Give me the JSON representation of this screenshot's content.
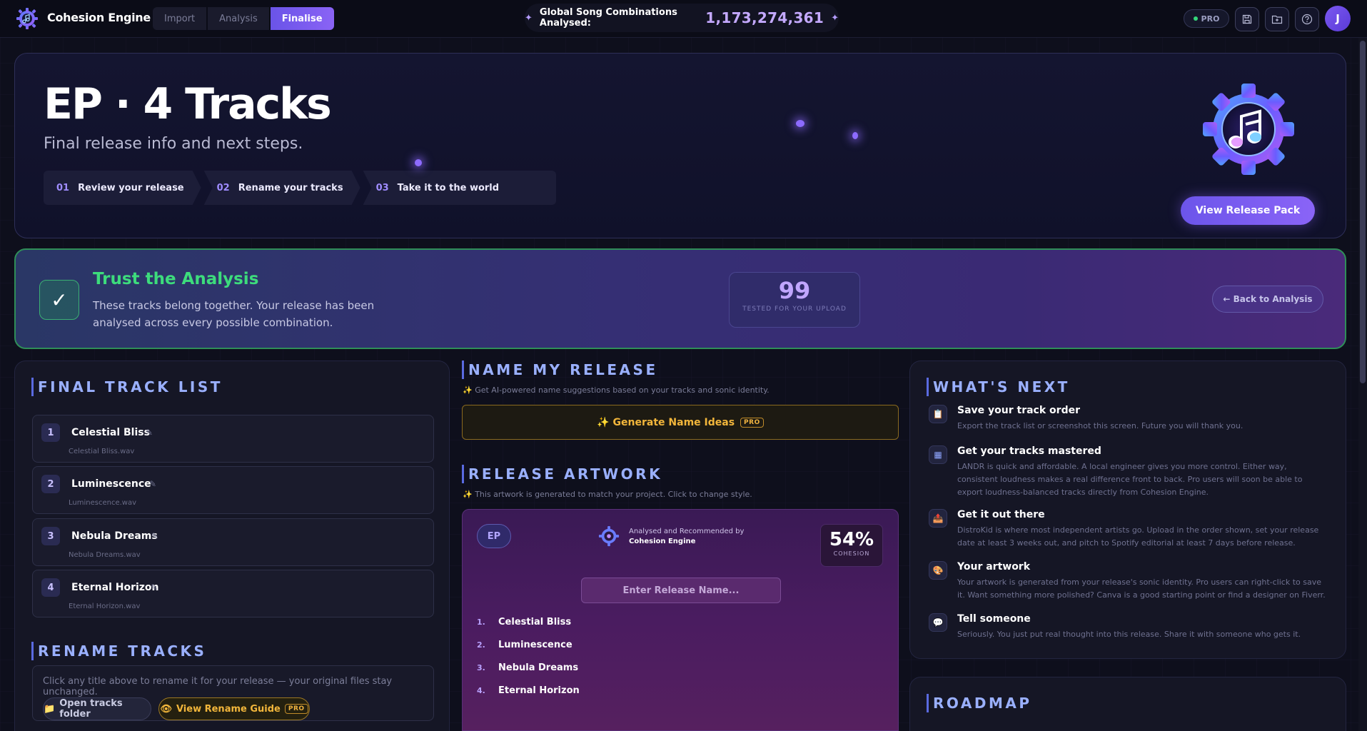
{
  "app": {
    "name": "Cohesion Engine"
  },
  "nav": {
    "steps": [
      "Import",
      "Analysis",
      "Finalise"
    ],
    "active_index": 2
  },
  "counter": {
    "label": "Global Song Combinations Analysed:",
    "value": "1,173,274,361"
  },
  "header": {
    "pro_label": "PRO",
    "avatar_initial": "J"
  },
  "colors": {
    "accent": "#7b5cf2",
    "success": "#3ddc7c",
    "gold": "#f2b63b",
    "section_title": "#9ab0ff"
  },
  "hero": {
    "title": "EP · 4 Tracks",
    "subtitle": "Final release info and next steps.",
    "process": [
      {
        "num": "01",
        "label": "Review your release"
      },
      {
        "num": "02",
        "label": "Rename your tracks"
      },
      {
        "num": "03",
        "label": "Take it to the world"
      }
    ],
    "cta": "View Release Pack"
  },
  "trust": {
    "title": "Trust the Analysis",
    "text": "These tracks belong together. Your release has been analysed across every possible combination.",
    "score": "99",
    "score_label": "TESTED FOR YOUR UPLOAD",
    "back": "← Back to Analysis"
  },
  "tracklist": {
    "title": "FINAL TRACK LIST",
    "tracks": [
      {
        "num": "1",
        "name": "Celestial Bliss",
        "file": "Celestial Bliss.wav"
      },
      {
        "num": "2",
        "name": "Luminescence",
        "file": "Luminescence.wav"
      },
      {
        "num": "3",
        "name": "Nebula Dreams",
        "file": "Nebula Dreams.wav"
      },
      {
        "num": "4",
        "name": "Eternal Horizon",
        "file": "Eternal Horizon.wav"
      }
    ]
  },
  "rename": {
    "title": "RENAME TRACKS",
    "hint": "Click any title above to rename it for your release — your original files stay unchanged.",
    "open_folder": "Open tracks folder",
    "guide": "View Rename Guide",
    "guide_tag": "PRO"
  },
  "naming": {
    "title": "NAME MY RELEASE",
    "hint": "✨ Get AI-powered name suggestions based on your tracks and sonic identity.",
    "button": "✨ Generate Name Ideas",
    "button_tag": "PRO"
  },
  "artwork": {
    "title": "RELEASE ARTWORK",
    "hint": "✨ This artwork is generated to match your project. Click to change style.",
    "badge": "EP",
    "rec_line1": "Analysed and Recommended by",
    "rec_line2": "Cohesion Engine",
    "cohesion_pct": "54%",
    "cohesion_label": "COHESION",
    "name_placeholder": "Enter Release Name...",
    "tracks": [
      {
        "i": "1.",
        "name": "Celestial Bliss"
      },
      {
        "i": "2.",
        "name": "Luminescence"
      },
      {
        "i": "3.",
        "name": "Nebula Dreams"
      },
      {
        "i": "4.",
        "name": "Eternal Horizon"
      }
    ]
  },
  "whats_next": {
    "title": "WHAT'S NEXT",
    "items": [
      {
        "icon": "clipboard-icon",
        "glyph": "📋",
        "title": "Save your track order",
        "desc": "Export the track list or screenshot this screen. Future you will thank you."
      },
      {
        "icon": "grid-icon",
        "glyph": "▦",
        "title": "Get your tracks mastered",
        "desc": "LANDR is quick and affordable. A local engineer gives you more control. Either way, consistent loudness makes a real difference front to back. Pro users will soon be able to export loudness-balanced tracks directly from Cohesion Engine."
      },
      {
        "icon": "upload-icon",
        "glyph": "📤",
        "title": "Get it out there",
        "desc": "DistroKid is where most independent artists go. Upload in the order shown, set your release date at least 3 weeks out, and pitch to Spotify editorial at least 7 days before release."
      },
      {
        "icon": "palette-icon",
        "glyph": "🎨",
        "title": "Your artwork",
        "desc": "Your artwork is generated from your release's sonic identity. Pro users can right-click to save it. Want something more polished? Canva is a good starting point or find a designer on Fiverr."
      },
      {
        "icon": "speech-bubble-icon",
        "glyph": "💬",
        "title": "Tell someone",
        "desc": "Seriously. You just put real thought into this release. Share it with someone who gets it."
      }
    ]
  },
  "roadmap": {
    "title": "ROADMAP"
  }
}
